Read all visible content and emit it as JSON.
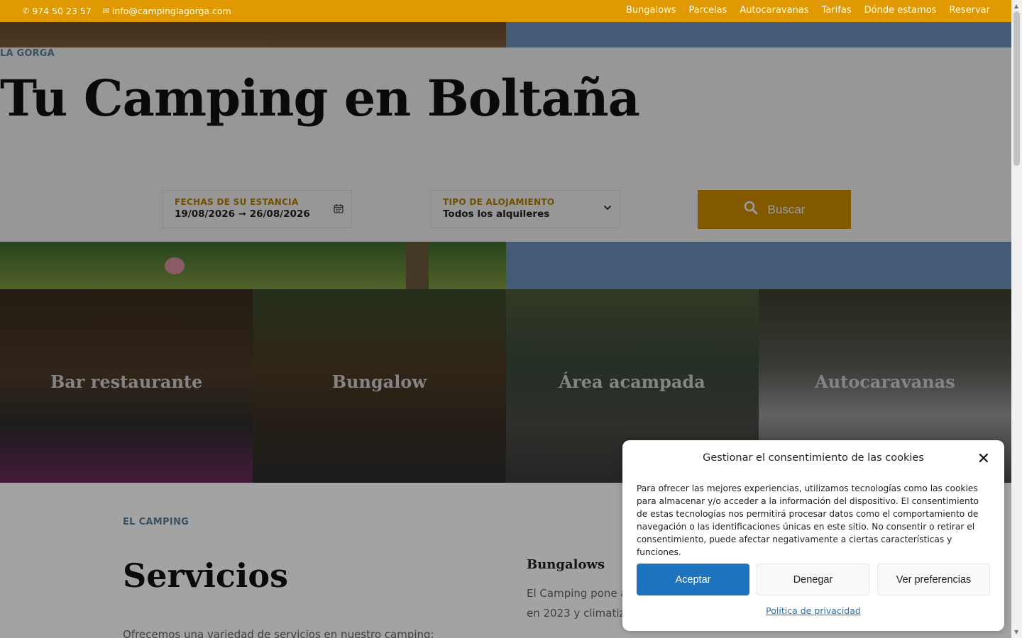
{
  "topbar": {
    "phone": "974 50 23 57",
    "email": "info@campinglagorga.com",
    "nav": [
      "Bungalows",
      "Parcelas",
      "Autocaravanas",
      "Tarifas",
      "Dónde estamos",
      "Reservar"
    ]
  },
  "hero": {
    "subtitle": "LA GORGA",
    "title": "Tu Camping en Boltaña",
    "search": {
      "dates_label": "FECHAS DE SU ESTANCIA",
      "dates_value": "19/08/2026 ➞ 26/08/2026",
      "type_label": "TIPO DE ALOJAMIENTO",
      "type_value": "Todos los alquileres",
      "button_label": "Buscar"
    }
  },
  "tiles": [
    {
      "title": "Bar restaurante"
    },
    {
      "title": "Bungalow"
    },
    {
      "title": "Área acampada"
    },
    {
      "title": "Autocaravanas"
    }
  ],
  "content": {
    "label": "EL CAMPING",
    "title": "Servicios",
    "intro": "Ofrecemos una variedad de servicios en nuestro camping:",
    "col_title": "Bungalows",
    "col_text": "El Camping pone a\nen 2023 y climatiz"
  },
  "cookie": {
    "title": "Gestionar el consentimiento de las cookies",
    "text": "Para ofrecer las mejores experiencias, utilizamos tecnologías como las cookies para almacenar y/o acceder a la información del dispositivo. El consentimiento de estas tecnologías nos permitirá procesar datos como el comportamiento de navegación o las identificaciones únicas en este sitio. No consentir o retirar el consentimiento, puede afectar negativamente a ciertas características y funciones.",
    "accept": "Aceptar",
    "deny": "Denegar",
    "preferences": "Ver preferencias",
    "policy_link": "Política de privacidad"
  },
  "colors": {
    "topbar": "#e09900",
    "accent_button": "#cc8c00",
    "label_blue": "#5d7f99",
    "cookie_accept": "#1e73be"
  }
}
